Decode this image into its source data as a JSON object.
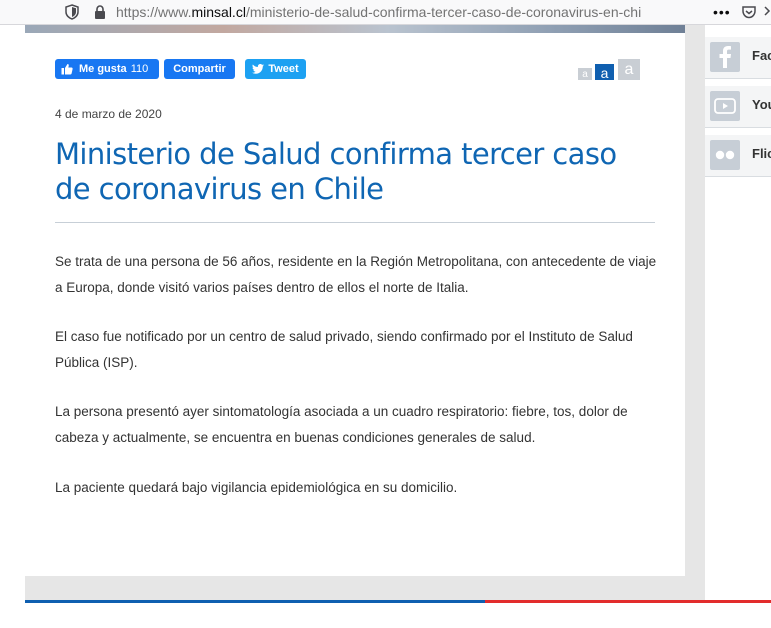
{
  "browser": {
    "url_prefix": "https://www.",
    "url_domain": "minsal.cl",
    "url_path": "/ministerio-de-salud-confirma-tercer-caso-de-coronavirus-en-chi",
    "page_actions": "•••"
  },
  "share": {
    "like_label": "Me gusta",
    "like_count": "110",
    "share_label": "Compartir",
    "tweet_label": "Tweet"
  },
  "font_size_controls": {
    "small": "a",
    "medium": "a",
    "large": "a"
  },
  "article": {
    "date": "4 de marzo de 2020",
    "title": "Ministerio de Salud confirma tercer caso de coronavirus en Chile",
    "paragraphs": [
      "Se trata de una persona de 56 años, residente en la Región Metropolitana, con antecedente de viaje a Europa, donde visitó varios países dentro de ellos el norte de Italia.",
      "El caso fue notificado por un centro de salud privado, siendo confirmado por el Instituto de Salud Pública (ISP).",
      "La persona presentó ayer sintomatología asociada a un cuadro respiratorio: fiebre, tos, dolor de cabeza y actualmente, se encuentra en buenas condiciones generales de salud.",
      "La paciente quedará bajo vigilancia epidemiológica en su domicilio."
    ]
  },
  "social_sidebar": {
    "items": [
      {
        "label": "Fac",
        "icon": "facebook-icon"
      },
      {
        "label": "You",
        "icon": "youtube-icon"
      },
      {
        "label": "Flic",
        "icon": "flickr-icon"
      }
    ]
  },
  "colors": {
    "title_blue": "#0f66b3",
    "facebook_blue": "#1877f2",
    "twitter_blue": "#1da1f2",
    "footer_blue": "#0f5fb0",
    "footer_red": "#e22c2c"
  }
}
